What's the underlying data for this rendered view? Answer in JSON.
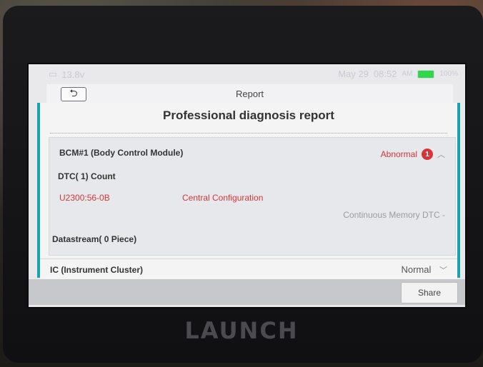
{
  "status_bar": {
    "voltage": "13.8v",
    "date": "May 29",
    "time": "08:52",
    "ampm": "AM",
    "battery_percent": "100%",
    "battery_level": 1.0
  },
  "titlebar": {
    "back_label": "⮌",
    "title": "Report"
  },
  "report": {
    "header": "Professional diagnosis report",
    "module1": {
      "name": "BCM#1 (Body Control Module)",
      "status": "Abnormal",
      "badge_count": "1",
      "dtc_count_label": "DTC( 1) Count",
      "dtc_code": "U2300:56-0B",
      "dtc_desc": "Central Configuration",
      "dtc_type": "Continuous Memory DTC -",
      "datastream_label": "Datastream( 0 Piece)"
    },
    "module2": {
      "name": "IC (Instrument Cluster)",
      "status": "Normal"
    }
  },
  "actions": {
    "share_label": "Share"
  },
  "brand": {
    "logo_text": "LAUNCH"
  },
  "colors": {
    "accent": "#17a3b0",
    "error": "#d5363a",
    "battery": "#2fd84a"
  }
}
